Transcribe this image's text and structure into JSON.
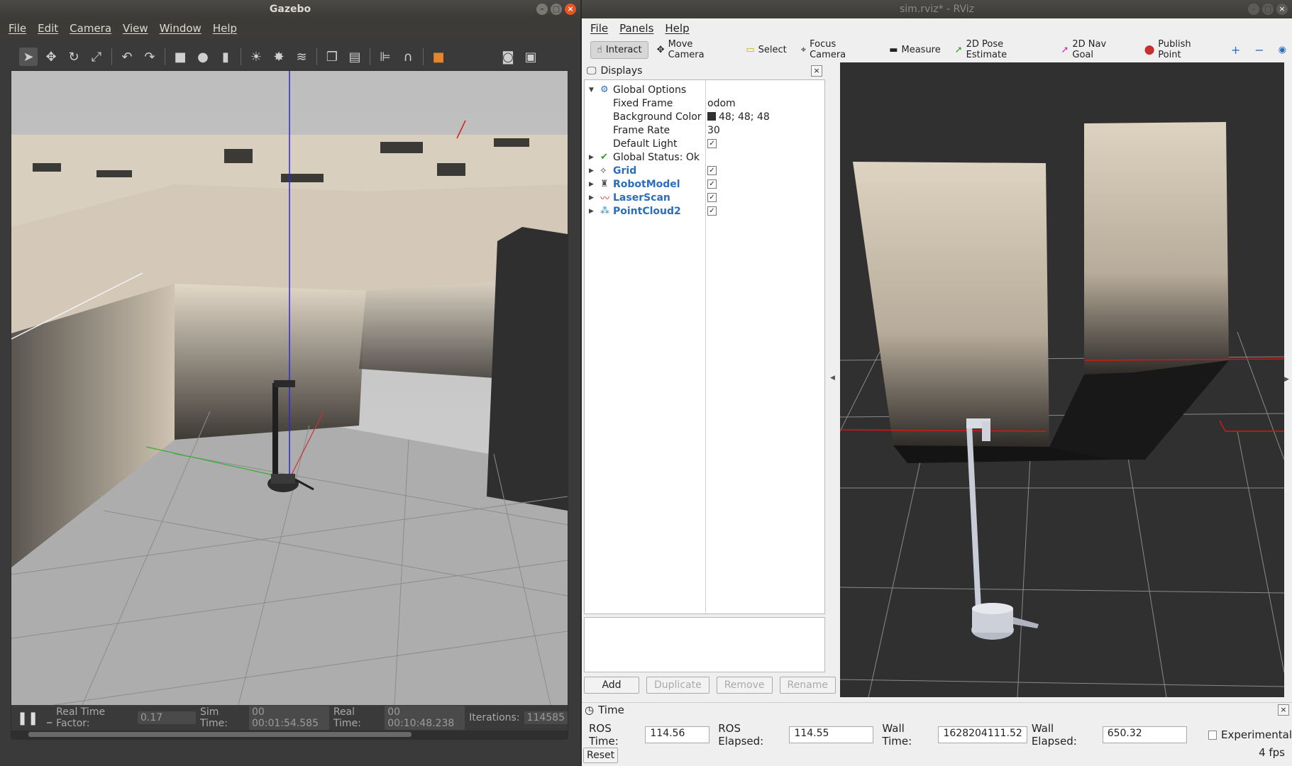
{
  "gazebo": {
    "title": "Gazebo",
    "menu": [
      "File",
      "Edit",
      "Camera",
      "View",
      "Window",
      "Help"
    ],
    "status": {
      "rtf_label": "Real Time Factor:",
      "rtf_value": "0.17",
      "sim_label": "Sim Time:",
      "sim_value": "00 00:01:54.585",
      "real_label": "Real Time:",
      "real_value": "00 00:10:48.238",
      "iter_label": "Iterations:",
      "iter_value": "114585"
    }
  },
  "rviz": {
    "title": "sim.rviz* - RViz",
    "menu": [
      "File",
      "Panels",
      "Help"
    ],
    "tools": [
      "Interact",
      "Move Camera",
      "Select",
      "Focus Camera",
      "Measure",
      "2D Pose Estimate",
      "2D Nav Goal",
      "Publish Point"
    ],
    "displays": {
      "title": "Displays",
      "global_options": "Global Options",
      "fixed_frame_label": "Fixed Frame",
      "fixed_frame_value": "odom",
      "bg_color_label": "Background Color",
      "bg_color_value": "48; 48; 48",
      "frame_rate_label": "Frame Rate",
      "frame_rate_value": "30",
      "default_light_label": "Default Light",
      "global_status": "Global Status: Ok",
      "items": [
        "Grid",
        "RobotModel",
        "LaserScan",
        "PointCloud2"
      ]
    },
    "buttons": {
      "add": "Add",
      "duplicate": "Duplicate",
      "remove": "Remove",
      "rename": "Rename"
    },
    "time": {
      "title": "Time",
      "ros_time_label": "ROS Time:",
      "ros_time": "114.56",
      "ros_elapsed_label": "ROS Elapsed:",
      "ros_elapsed": "114.55",
      "wall_time_label": "Wall Time:",
      "wall_time": "1628204111.52",
      "wall_elapsed_label": "Wall Elapsed:",
      "wall_elapsed": "650.32",
      "experimental": "Experimental",
      "reset": "Reset",
      "fps": "4 fps"
    }
  }
}
